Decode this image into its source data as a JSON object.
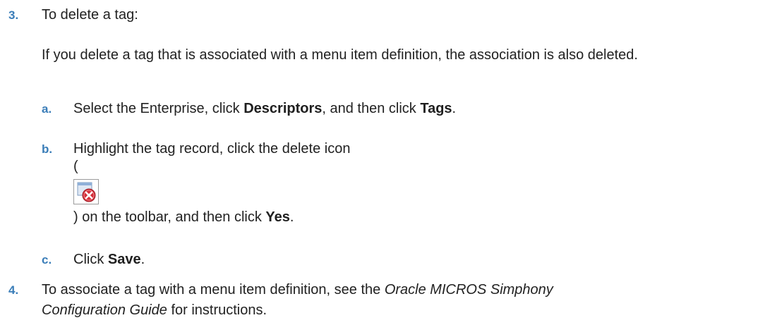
{
  "step3": {
    "number": "3.",
    "heading": "To delete a tag:",
    "note": "If you delete a tag that is associated with a menu item definition, the association is also deleted.",
    "substeps": {
      "a": {
        "letter": "a.",
        "pre": "Select the Enterprise, click ",
        "bold1": "Descriptors",
        "mid": ", and then click ",
        "bold2": "Tags",
        "post": "."
      },
      "b": {
        "letter": "b.",
        "line1": "Highlight the tag record, click the delete icon",
        "open_paren": "(",
        "icon": "delete-icon",
        "pre": ") on the toolbar, and then click ",
        "bold": "Yes",
        "post": "."
      },
      "c": {
        "letter": "c.",
        "pre": "Click ",
        "bold": "Save",
        "post": "."
      }
    }
  },
  "step4": {
    "number": "4.",
    "pre": "To associate a tag with a menu item definition, see the ",
    "italic_line1": "Oracle MICROS Simphony",
    "italic_line2": "Configuration Guide",
    "post": " for instructions."
  },
  "colors": {
    "accent": "#3a7db8",
    "text": "#222222",
    "icon_red": "#d42f3a"
  }
}
